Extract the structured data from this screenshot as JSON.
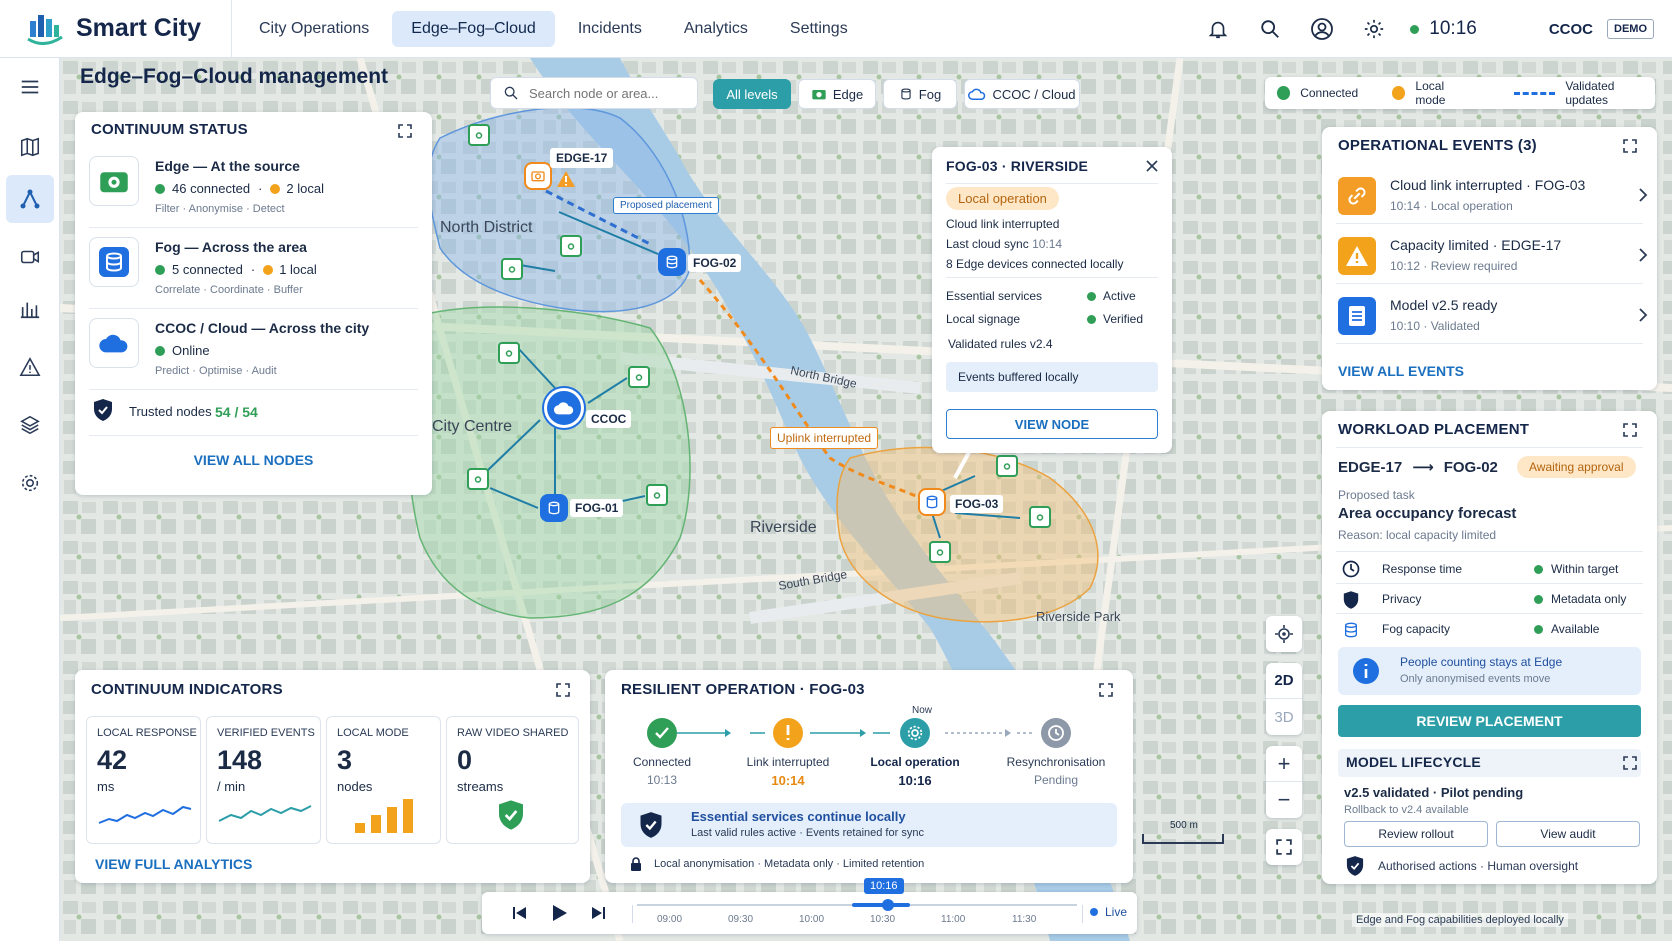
{
  "app": {
    "name": "Smart City",
    "org": "CCOC",
    "env_badge": "DEMO",
    "time": "10:16"
  },
  "nav": [
    "City Operations",
    "Edge–Fog–Cloud",
    "Incidents",
    "Analytics",
    "Settings"
  ],
  "page_title": "Edge–Fog–Cloud management",
  "search": {
    "placeholder": "Search node or area..."
  },
  "filters": {
    "all": "All levels",
    "edge": "Edge",
    "fog": "Fog",
    "cloud": "CCOC / Cloud"
  },
  "legend": {
    "connected": "Connected",
    "local": "Local mode",
    "validated": "Validated updates"
  },
  "status": {
    "title": "CONTINUUM STATUS",
    "edge": {
      "title": "Edge — At the source",
      "connected": "46 connected",
      "sep": "·",
      "local": "2 local",
      "sub": "Filter · Anonymise · Detect"
    },
    "fog": {
      "title": "Fog — Across the area",
      "connected": "5 connected",
      "sep": "·",
      "local": "1 local",
      "sub": "Correlate · Coordinate · Buffer"
    },
    "cloud": {
      "title": "CCOC / Cloud — Across the city",
      "status": "Online",
      "sub": "Predict · Optimise · Audit"
    },
    "trusted_label": "Trusted nodes",
    "trusted_value": "54 / 54",
    "link": "VIEW ALL NODES"
  },
  "map": {
    "north": "North District",
    "centre": "City Centre",
    "riverside": "Riverside",
    "north_bridge": "North Bridge",
    "south_bridge": "South Bridge",
    "park": "Riverside Park",
    "proposed": "Proposed placement",
    "uplink": "Uplink interrupted",
    "edge17": "EDGE-17",
    "fog02": "FOG-02",
    "fog01": "FOG-01",
    "fog03": "FOG-03",
    "ccoc": "CCOC",
    "scale": "500 m",
    "footer": "Edge and Fog capabilities deployed locally"
  },
  "popup": {
    "title": "FOG-03 · RIVERSIDE",
    "badge": "Local operation",
    "line1": "Cloud link interrupted",
    "line2_label": "Last cloud sync",
    "line2_value": "10:14",
    "line3": "8 Edge devices connected locally",
    "svc1": "Essential services",
    "svc1_val": "Active",
    "svc2": "Local signage",
    "svc2_val": "Verified",
    "rules": "Validated rules v2.4",
    "buffer": "Events buffered locally",
    "button": "VIEW NODE"
  },
  "events": {
    "title": "OPERATIONAL EVENTS (3)",
    "items": [
      {
        "title": "Cloud link interrupted · FOG-03",
        "sub": "10:14  ·  Local operation",
        "color": "#f39c26"
      },
      {
        "title": "Capacity limited · EDGE-17",
        "sub": "10:12  ·  Review required",
        "color": "#f3a21c"
      },
      {
        "title": "Model v2.5 ready",
        "sub": "10:10  ·  Validated",
        "color": "#1f6fe0"
      }
    ],
    "link": "VIEW ALL EVENTS"
  },
  "workload": {
    "title": "WORKLOAD PLACEMENT",
    "from": "EDGE-17",
    "arrow": "⟶",
    "to": "FOG-02",
    "badge": "Awaiting approval",
    "task_label": "Proposed task",
    "task": "Area occupancy forecast",
    "reason": "Reason: local capacity limited",
    "checks": [
      {
        "label": "Response time",
        "value": "Within target"
      },
      {
        "label": "Privacy",
        "value": "Metadata only"
      },
      {
        "label": "Fog capacity",
        "value": "Available"
      }
    ],
    "info1": "People counting stays at Edge",
    "info2": "Only anonymised events move",
    "button": "REVIEW PLACEMENT"
  },
  "lifecycle": {
    "title": "MODEL LIFECYCLE",
    "line1": "v2.5 validated · Pilot pending",
    "line2": "Rollback to v2.4 available",
    "btn1": "Review rollout",
    "btn2": "View audit",
    "footer": "Authorised actions · Human oversight"
  },
  "indicators": {
    "title": "CONTINUUM INDICATORS",
    "cards": [
      {
        "label": "LOCAL RESPONSE",
        "value": "42",
        "unit": "ms"
      },
      {
        "label": "VERIFIED EVENTS",
        "value": "148",
        "unit": "/ min"
      },
      {
        "label": "LOCAL MODE",
        "value": "3",
        "unit": "nodes"
      },
      {
        "label": "RAW VIDEO SHARED",
        "value": "0",
        "unit": "streams"
      }
    ],
    "link": "VIEW FULL ANALYTICS"
  },
  "resilient": {
    "title": "RESILIENT OPERATION · FOG-03",
    "now": "Now",
    "steps": [
      {
        "label": "Connected",
        "time": "10:13"
      },
      {
        "label": "Link interrupted",
        "time": "10:14"
      },
      {
        "label": "Local operation",
        "time": "10:16"
      },
      {
        "label": "Resynchronisation",
        "time": "Pending"
      }
    ],
    "notice_title": "Essential services continue locally",
    "notice_sub": "Last valid rules active · Events retained for sync",
    "footer": "Local anonymisation · Metadata only · Limited retention"
  },
  "timeline": {
    "current": "10:16",
    "ticks": [
      "09:00",
      "09:30",
      "10:00",
      "10:30",
      "11:00",
      "11:30"
    ],
    "live": "Live"
  },
  "map_controls": {
    "view2d": "2D",
    "view3d": "3D",
    "zoom_in": "+",
    "zoom_out": "−"
  },
  "colors": {
    "accent": "#1b6fbf",
    "connected": "#2f9e57",
    "local": "#f39c26",
    "teal": "#2c9ea8"
  }
}
